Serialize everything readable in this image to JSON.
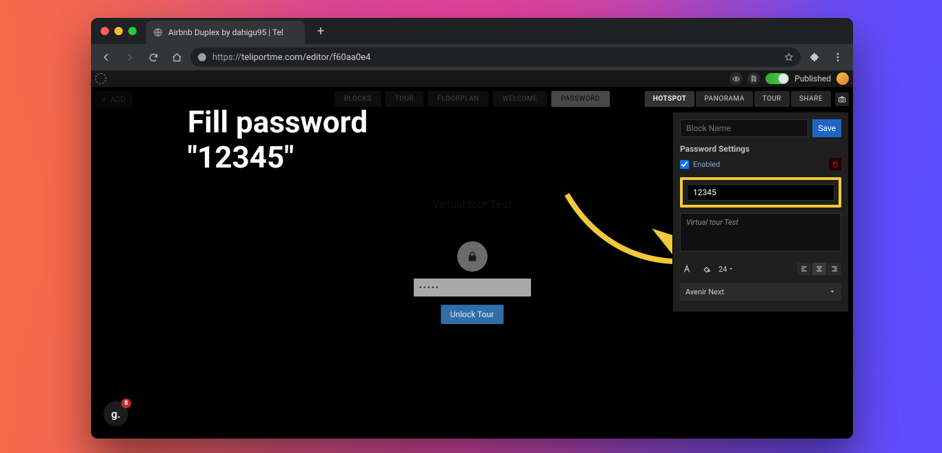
{
  "browser": {
    "tab_title": "Airbnb Duplex by dahigu95 | Tel",
    "url_protocol": "https://",
    "url_rest": "teliportme.com/editor/f60aa0e4",
    "close_tab": "×"
  },
  "traffic": {
    "close": "#ff5f57",
    "min": "#febc2e",
    "max": "#28c840"
  },
  "overlay": {
    "line1": "Fill password",
    "line2": "\"12345\""
  },
  "app": {
    "add_label": "ADD",
    "center_tabs": [
      "BLOCKS",
      "TOUR",
      "FLOORPLAN",
      "WELCOME",
      "PASSWORD"
    ],
    "center_active_index": 4,
    "right_tabs": [
      "HOTSPOT",
      "PANORAMA",
      "TOUR",
      "SHARE"
    ],
    "right_active_index": 0,
    "published_label": "Published"
  },
  "preview": {
    "title": "Virtual tour Test",
    "password_dots": "•••••",
    "unlock_label": "Unlock Tour"
  },
  "panel": {
    "blockname_placeholder": "Block Name",
    "save_label": "Save",
    "settings_title": "Password Settings",
    "enabled_label": "Enabled",
    "password_value": "12345",
    "description_value": "Virtual tour Test",
    "font_size": "24",
    "font_family": "Avenir Next"
  },
  "badge": {
    "letter": "g.",
    "count": "8"
  }
}
